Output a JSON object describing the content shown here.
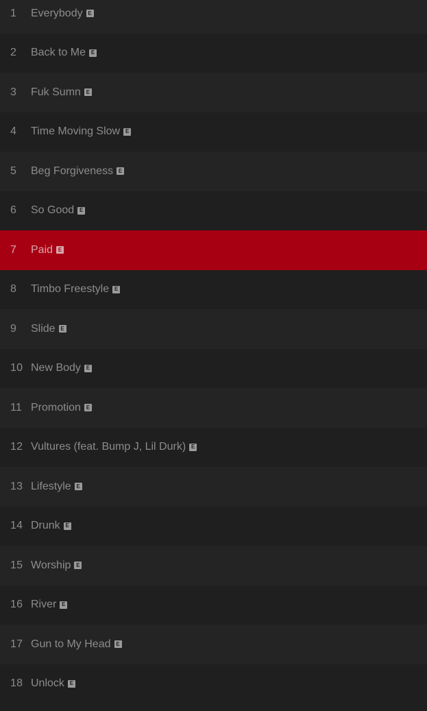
{
  "explicit_glyph": "E",
  "colors": {
    "background": "#1f1f1f",
    "row_alt": "#242424",
    "active": "#a80013",
    "text": "#8c8c8c"
  },
  "active_index": 6,
  "tracks": [
    {
      "num": "1",
      "title": "Everybody"
    },
    {
      "num": "2",
      "title": "Back to Me"
    },
    {
      "num": "3",
      "title": "Fuk Sumn"
    },
    {
      "num": "4",
      "title": "Time Moving Slow"
    },
    {
      "num": "5",
      "title": "Beg Forgiveness"
    },
    {
      "num": "6",
      "title": "So Good"
    },
    {
      "num": "7",
      "title": "Paid"
    },
    {
      "num": "8",
      "title": "Timbo Freestyle"
    },
    {
      "num": "9",
      "title": "Slide"
    },
    {
      "num": "10",
      "title": "New Body"
    },
    {
      "num": "11",
      "title": "Promotion"
    },
    {
      "num": "12",
      "title": "Vultures (feat. Bump J, Lil Durk)"
    },
    {
      "num": "13",
      "title": "Lifestyle"
    },
    {
      "num": "14",
      "title": "Drunk"
    },
    {
      "num": "15",
      "title": "Worship"
    },
    {
      "num": "16",
      "title": "River"
    },
    {
      "num": "17",
      "title": "Gun to My Head"
    },
    {
      "num": "18",
      "title": "Unlock"
    }
  ]
}
